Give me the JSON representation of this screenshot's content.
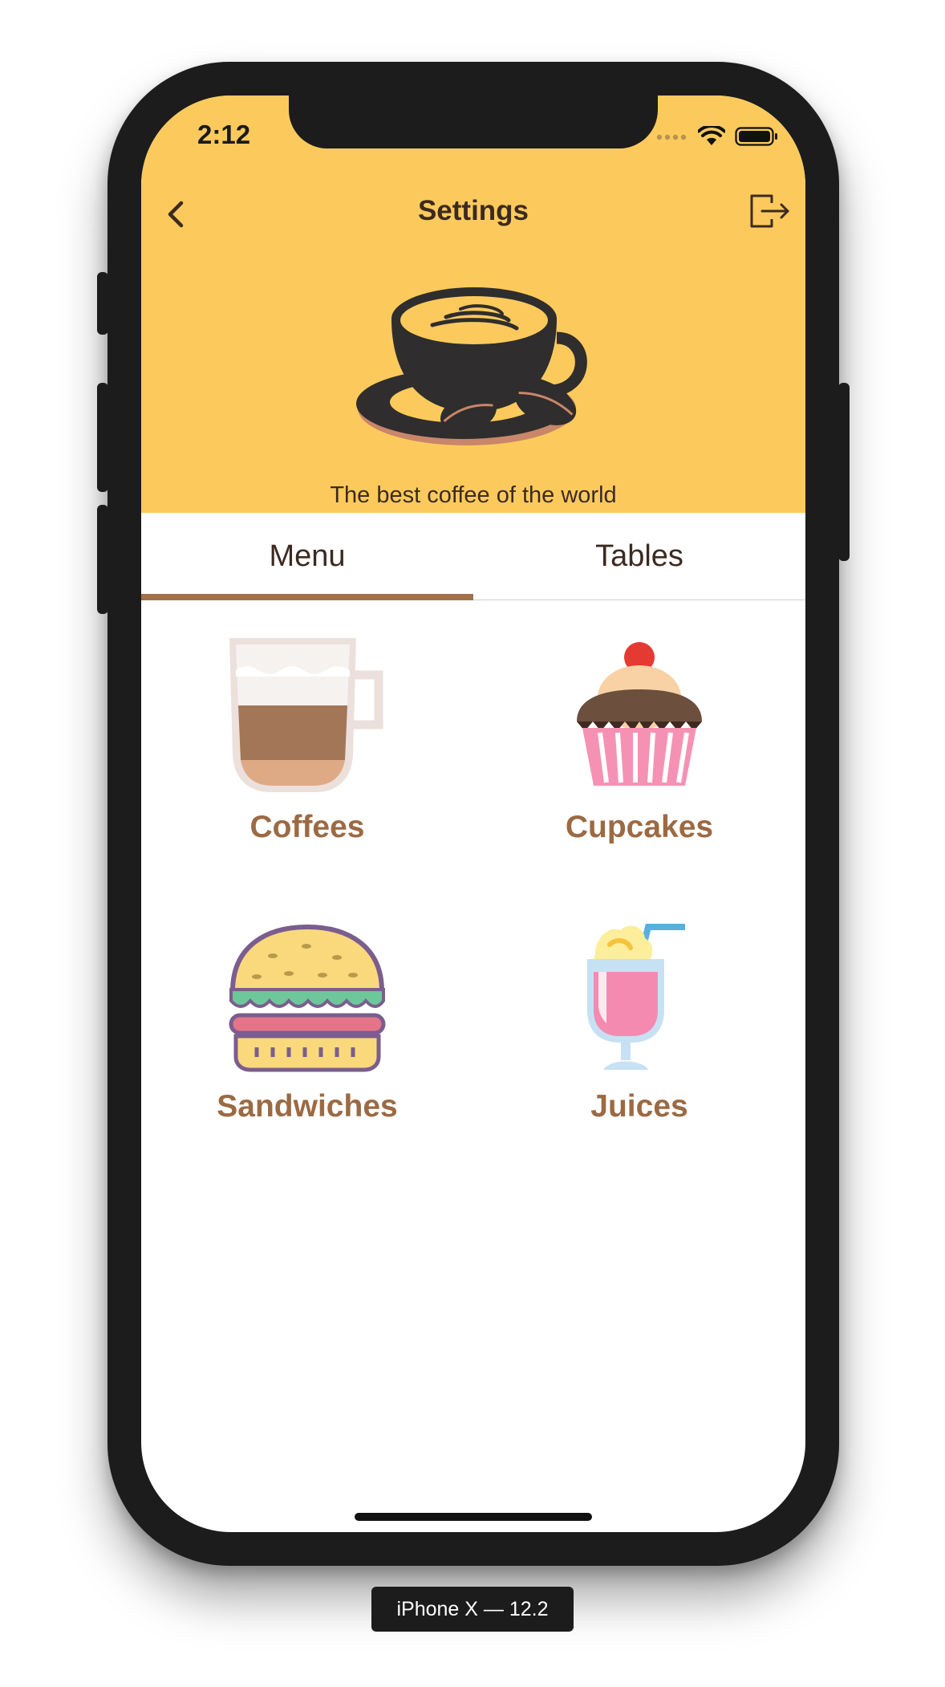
{
  "status_bar": {
    "time": "2:12"
  },
  "nav": {
    "title": "Settings",
    "back_icon": "chevron-left-icon",
    "logout_icon": "logout-icon"
  },
  "header": {
    "tagline": "The best coffee of the world",
    "logo_icon": "coffee-cup-logo"
  },
  "tabs": [
    {
      "label": "Menu",
      "selected": true
    },
    {
      "label": "Tables",
      "selected": false
    }
  ],
  "categories": [
    {
      "label": "Coffees",
      "icon": "latte-glass-icon"
    },
    {
      "label": "Cupcakes",
      "icon": "cupcake-icon"
    },
    {
      "label": "Sandwiches",
      "icon": "burger-icon"
    },
    {
      "label": "Juices",
      "icon": "milkshake-icon"
    }
  ],
  "device": {
    "label": "iPhone X — 12.2"
  },
  "colors": {
    "header_bg": "#fcca5c",
    "accent_brown": "#a2714a",
    "label_brown": "#9b6a43",
    "text_dark": "#3c2a20"
  }
}
